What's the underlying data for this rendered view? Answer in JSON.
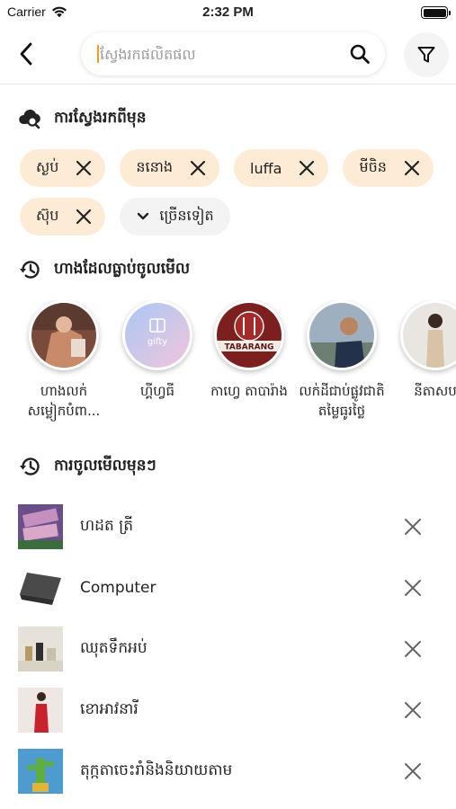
{
  "status_bar": {
    "carrier": "Carrier",
    "time": "2:32 PM"
  },
  "search": {
    "placeholder": "ស្វែងរកផលិតផល",
    "value": ""
  },
  "sections": {
    "recent_searches_title": "ការស្វែងរកពីមុន",
    "visited_shops_title": "ហាងដែលធ្លាប់ចូលមើល",
    "recently_viewed_title": "ការចូលមើលមុនៗ"
  },
  "recent_searches": [
    {
      "label": "ស្ងប់"
    },
    {
      "label": "ននោង"
    },
    {
      "label": "luffa"
    },
    {
      "label": "មីចិន"
    },
    {
      "label": "ស៊ុប"
    }
  ],
  "more_label": "ច្រើនទៀត",
  "shops": [
    {
      "name": "ហាងលក់ សម្លៀកបំពា..."
    },
    {
      "name": "ហ្គីហ្វធី",
      "logo_text": "gifty"
    },
    {
      "name": "កាហ្វេ តាបារ៉ាង",
      "logo_text": "TABARANG"
    },
    {
      "name": "លក់ដីជាប់ផ្លូវជាតិ តម្លៃធូរថ្លៃ"
    },
    {
      "name": "នីតាសប"
    }
  ],
  "recently_viewed": [
    {
      "title": "ហដត ត្រី"
    },
    {
      "title": "Computer"
    },
    {
      "title": "ឈុតទឹកអប់"
    },
    {
      "title": "ខោអាវនារី"
    },
    {
      "title": "តុក្កតាចេះរាំនិងនិយាយតាម"
    }
  ],
  "colors": {
    "chip_bg": "#fdebd5",
    "more_chip_bg": "#f3f3f3",
    "caret": "#f29b1d",
    "icon": "#222222",
    "remove_icon": "#666666"
  }
}
